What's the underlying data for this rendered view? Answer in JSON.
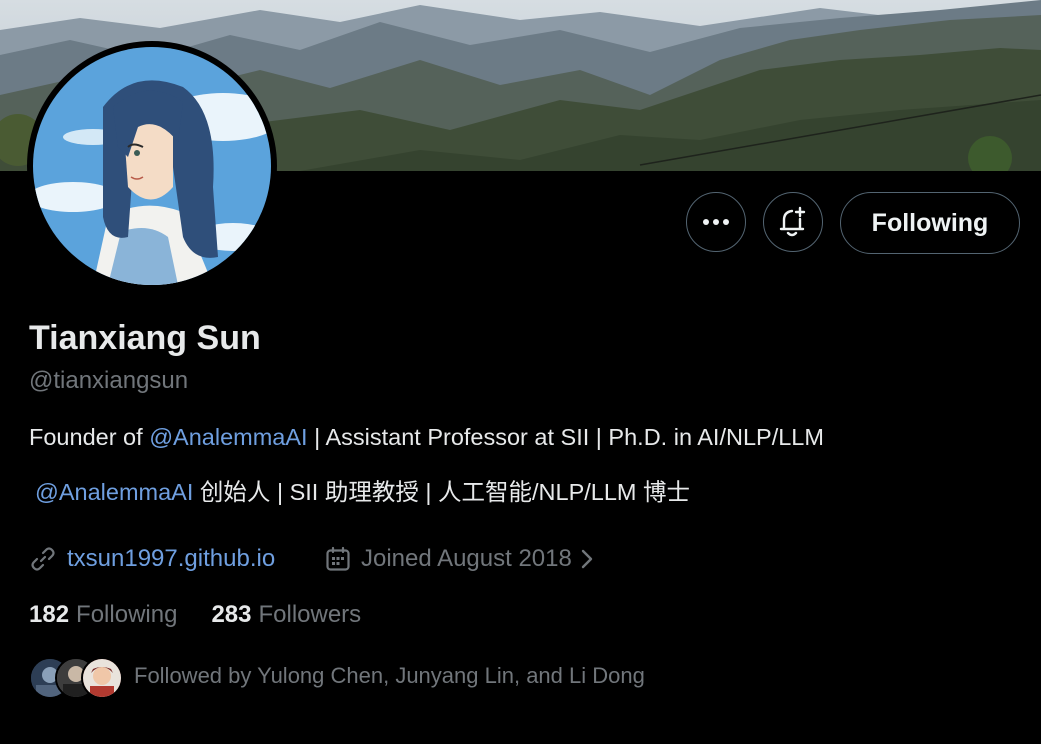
{
  "profile": {
    "name": "Tianxiang Sun",
    "handle": "@tianxiangsun",
    "bio": {
      "line1_prefix": "Founder of ",
      "line1_mention": "@AnalemmaAI",
      "line1_suffix": " | Assistant Professor at SII | Ph.D. in AI/NLP/LLM",
      "line2_mention": "@AnalemmaAI",
      "line2_suffix": " 创始人 | SII 助理教授 | 人工智能/NLP/LLM 博士"
    },
    "website": "txsun1997.github.io",
    "joined": "Joined August 2018"
  },
  "actions": {
    "more_icon": "more-dots-icon",
    "notify_icon": "bell-plus-icon",
    "following_label": "Following"
  },
  "stats": {
    "following_count": "182",
    "following_label": "Following",
    "followers_count": "283",
    "followers_label": "Followers"
  },
  "followed_by": {
    "text": "Followed by Yulong Chen, Junyang Lin, and Li Dong"
  },
  "colors": {
    "background": "#000000",
    "text_primary": "#e7e9ea",
    "text_secondary": "#71767b",
    "link": "#6f9fe0",
    "border": "#536471"
  }
}
